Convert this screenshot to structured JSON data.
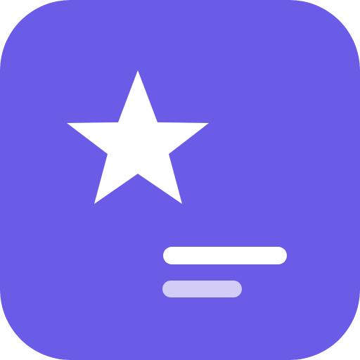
{
  "icon": {
    "name": "star-icon-app-tile",
    "glyph": "star-icon",
    "colors": {
      "background": "#6B5CE7",
      "star": "#FFFFFF",
      "primary_line": "#FFFFFF",
      "secondary_line": "#D2CCF6"
    }
  }
}
